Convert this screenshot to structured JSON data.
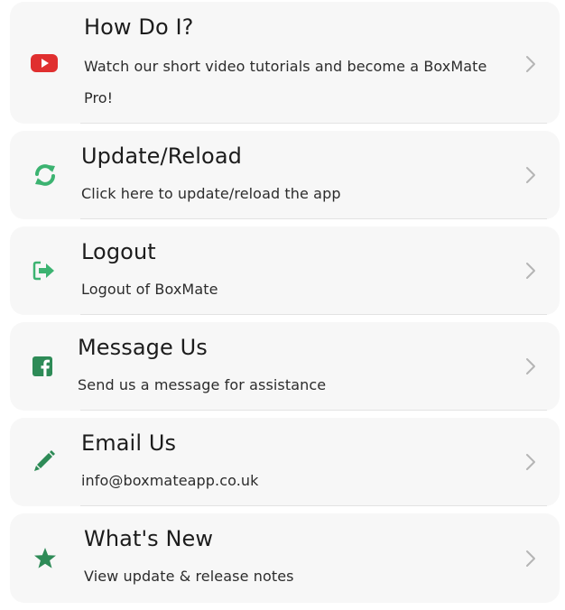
{
  "menu": {
    "items": [
      {
        "icon": "youtube-icon",
        "icon_color": "#e02f2f",
        "title": "How Do I?",
        "subtitle": "Watch our short video tutorials and become a BoxMate Pro!"
      },
      {
        "icon": "refresh-icon",
        "icon_color": "#3cb371",
        "title": "Update/Reload",
        "subtitle": "Click here to update/reload the app"
      },
      {
        "icon": "logout-icon",
        "icon_color": "#3cb371",
        "title": "Logout",
        "subtitle": "Logout of BoxMate"
      },
      {
        "icon": "facebook-icon",
        "icon_color": "#2e8b57",
        "title": "Message Us",
        "subtitle": "Send us a message for assistance"
      },
      {
        "icon": "pencil-icon",
        "icon_color": "#2e8b57",
        "title": "Email Us",
        "subtitle": "info@boxmateapp.co.uk"
      },
      {
        "icon": "star-icon",
        "icon_color": "#2e8b57",
        "title": "What's New",
        "subtitle": "View update & release notes"
      }
    ],
    "chevron_icon": "chevron-right-icon",
    "chevron_color": "#b5b5b5"
  }
}
